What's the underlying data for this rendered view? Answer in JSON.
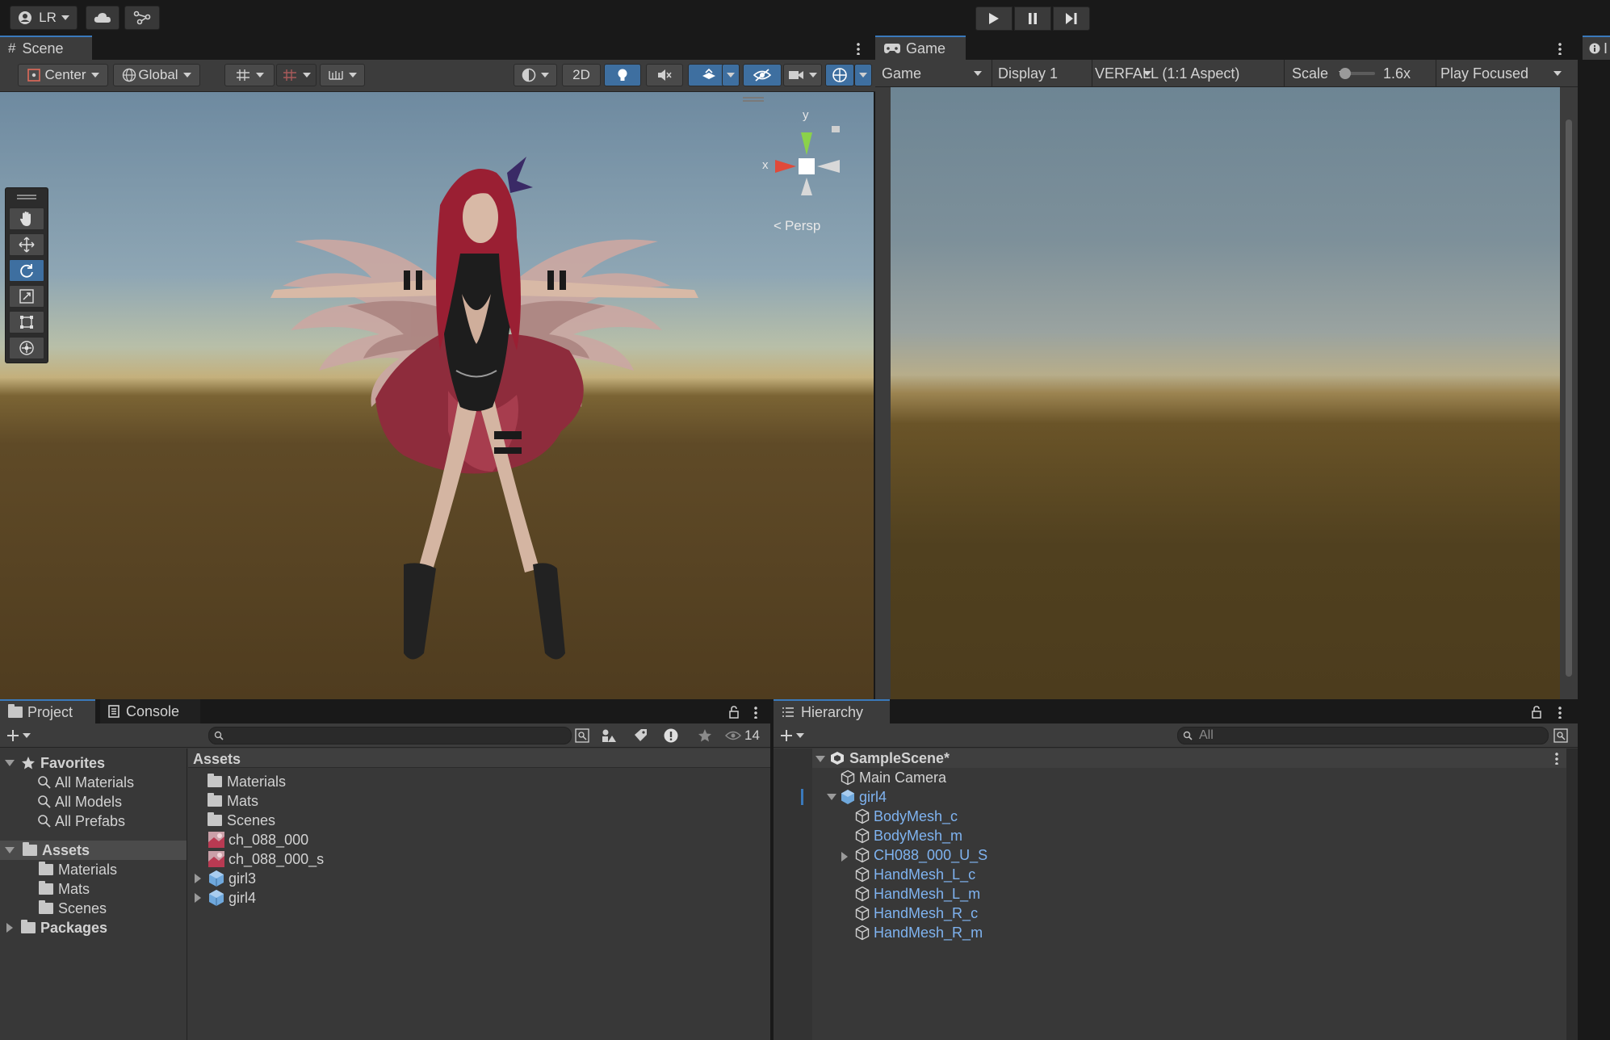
{
  "topbar": {
    "account_label": "LR",
    "cloud_icon": "cloud-icon",
    "collab_icon": "collab-icon",
    "play_icon": "play-icon",
    "pause_icon": "pause-icon",
    "step_icon": "step-icon"
  },
  "scene": {
    "tab_label": "Scene",
    "pivot_label": "Center",
    "space_label": "Global",
    "mode_2d_label": "2D",
    "gizmo": {
      "y": "y",
      "x": "x",
      "projection": "Persp"
    }
  },
  "game": {
    "tab_label": "Game",
    "view_select": "Game",
    "display_select": "Display 1",
    "aspect_select": "VERFALL (1:1 Aspect)",
    "scale_label": "Scale",
    "scale_value": "1.6x",
    "play_mode_select": "Play Focused",
    "scale_level": 0.1
  },
  "inspector": {
    "tab_fragment": "I"
  },
  "project": {
    "tab_project": "Project",
    "tab_console": "Console",
    "visible_count": "14",
    "favorites": {
      "label": "Favorites",
      "items": [
        "All Materials",
        "All Models",
        "All Prefabs"
      ]
    },
    "assets_tree": {
      "label": "Assets",
      "children": [
        "Materials",
        "Mats",
        "Scenes"
      ]
    },
    "packages_label": "Packages",
    "assets_header": "Assets",
    "asset_items": [
      {
        "name": "Materials",
        "type": "folder"
      },
      {
        "name": "Mats",
        "type": "folder"
      },
      {
        "name": "Scenes",
        "type": "folder"
      },
      {
        "name": "ch_088_000",
        "type": "texture"
      },
      {
        "name": "ch_088_000_s",
        "type": "texture"
      },
      {
        "name": "girl3",
        "type": "model"
      },
      {
        "name": "girl4",
        "type": "model"
      }
    ]
  },
  "hierarchy": {
    "tab_label": "Hierarchy",
    "search_placeholder": "All",
    "scene_name": "SampleScene*",
    "items": [
      {
        "name": "Main Camera",
        "depth": 1,
        "prefab": false,
        "expandable": false
      },
      {
        "name": "girl4",
        "depth": 1,
        "prefab": true,
        "expandable": true
      },
      {
        "name": "BodyMesh_c",
        "depth": 2,
        "prefab": true,
        "expandable": false
      },
      {
        "name": "BodyMesh_m",
        "depth": 2,
        "prefab": true,
        "expandable": false
      },
      {
        "name": "CH088_000_U_S",
        "depth": 2,
        "prefab": true,
        "expandable": true
      },
      {
        "name": "HandMesh_L_c",
        "depth": 2,
        "prefab": true,
        "expandable": false
      },
      {
        "name": "HandMesh_L_m",
        "depth": 2,
        "prefab": true,
        "expandable": false
      },
      {
        "name": "HandMesh_R_c",
        "depth": 2,
        "prefab": true,
        "expandable": false
      },
      {
        "name": "HandMesh_R_m",
        "depth": 2,
        "prefab": true,
        "expandable": false
      }
    ]
  },
  "colors": {
    "accent_blue": "#3e6fa0",
    "prefab_text": "#7fb3f0",
    "panel_bg": "#383838",
    "toolbar_bg": "#191919"
  }
}
